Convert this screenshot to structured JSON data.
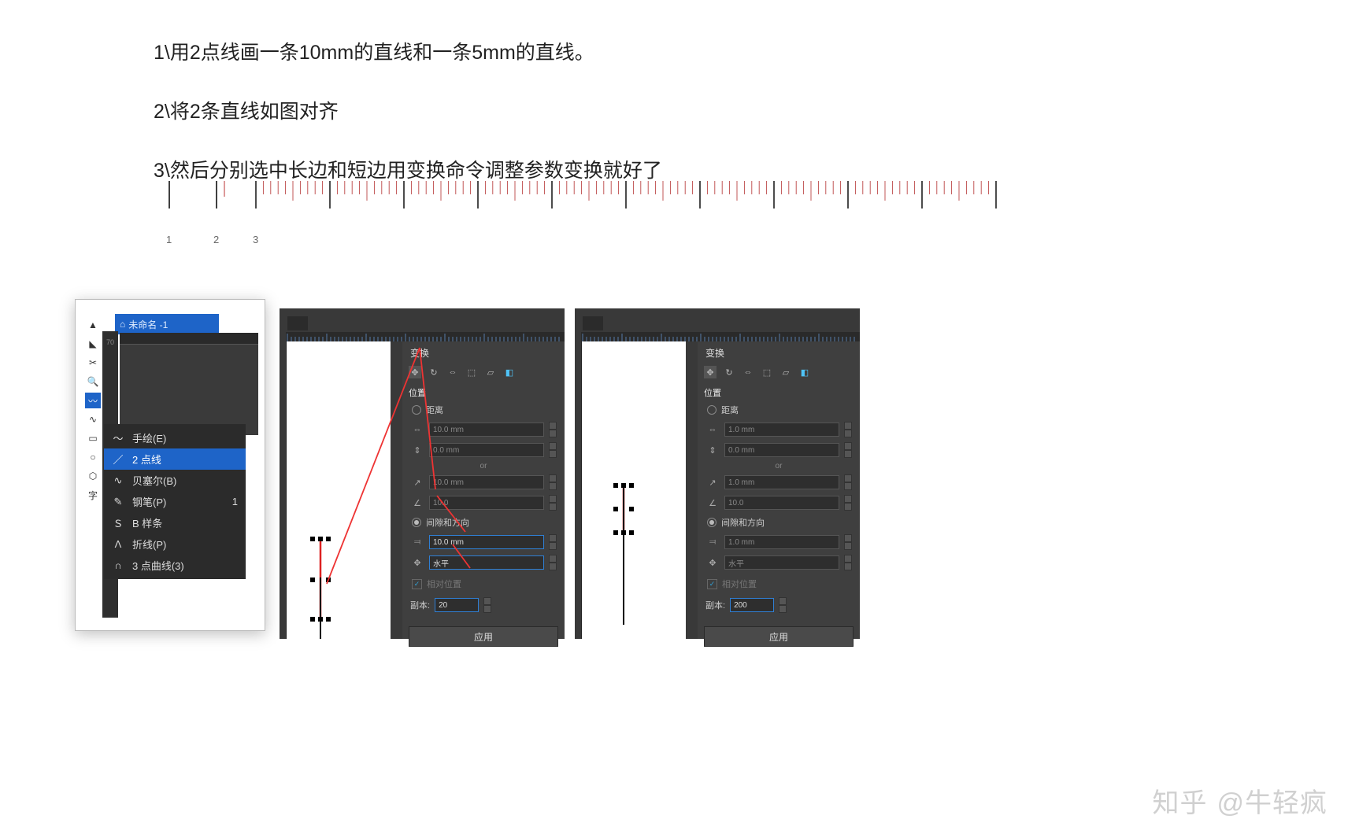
{
  "instructions": {
    "step1": "1\\用2点线画一条10mm的直线和一条5mm的直线。",
    "step2": "2\\将2条直线如图对齐",
    "step3": "3\\然后分别选中长边和短边用变换命令调整参数变换就好了"
  },
  "ruler_labels": {
    "l1": "1",
    "l2": "2",
    "l3": "3"
  },
  "shot_a": {
    "doc_title": "未命名 -1",
    "ruler_mark": "70",
    "flyout": {
      "items": [
        {
          "icon": "～",
          "label": "手绘(E)"
        },
        {
          "icon": "／",
          "label": "2 点线"
        },
        {
          "icon": "∿",
          "label": "贝塞尔(B)"
        },
        {
          "icon": "✎",
          "label": "钢笔(P)",
          "shortcut": "1"
        },
        {
          "icon": "Ｓ",
          "label": "B 样条"
        },
        {
          "icon": "Λ",
          "label": "折线(P)"
        },
        {
          "icon": "∩",
          "label": "3 点曲线(3)"
        }
      ],
      "selected_index": 1
    },
    "side_text": "字"
  },
  "panel_b": {
    "title": "变换",
    "section_position": "位置",
    "radio_distance": "距离",
    "dist_h": "10.0 mm",
    "dist_v": "0.0 mm",
    "or": "or",
    "angle_len": "10.0 mm",
    "angle_deg": "10.0",
    "radio_gap_dir": "间隙和方向",
    "gap_val": "10.0 mm",
    "dir_val": "水平",
    "relative": "相对位置",
    "copies_label": "副本:",
    "copies_val": "20",
    "apply": "应用"
  },
  "panel_c": {
    "title": "变换",
    "section_position": "位置",
    "radio_distance": "距离",
    "dist_h": "1.0 mm",
    "dist_v": "0.0 mm",
    "or": "or",
    "angle_len": "1.0 mm",
    "angle_deg": "10.0",
    "radio_gap_dir": "间隙和方向",
    "gap_val": "1.0 mm",
    "dir_val": "水平",
    "relative": "相对位置",
    "copies_label": "副本:",
    "copies_val": "200",
    "apply": "应用"
  },
  "watermark": {
    "brand": "知乎",
    "author": "@牛轻疯"
  }
}
